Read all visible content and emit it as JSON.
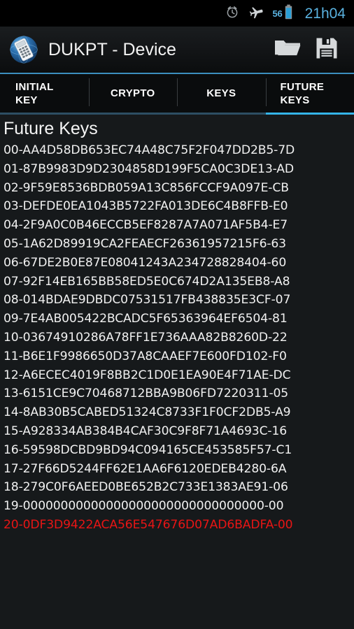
{
  "status_bar": {
    "icons": [
      "alarm-clock-icon",
      "airplane-mode-icon",
      "battery-icon"
    ],
    "battery_percent": "56",
    "time": "21h04",
    "accent_color": "#5ab2e0"
  },
  "action_bar": {
    "app_icon": "dukpt-app-icon",
    "title": "DUKPT - Device",
    "actions": [
      {
        "name": "open-folder-icon",
        "label": "Open"
      },
      {
        "name": "save-disk-icon",
        "label": "Save"
      }
    ],
    "divider_color": "#3c8fbf"
  },
  "tabs": {
    "selected_index": 3,
    "indicator_color": "#34b4e8",
    "items": [
      {
        "label": "INITIAL\nKEY",
        "name": "tab-initial-key"
      },
      {
        "label": "CRYPTO",
        "name": "tab-crypto"
      },
      {
        "label": "KEYS",
        "name": "tab-keys"
      },
      {
        "label": "FUTURE\nKEYS",
        "name": "tab-future-keys"
      }
    ]
  },
  "main": {
    "section_title": "Future Keys",
    "highlight_color": "#e81515",
    "text_color": "#f0f0f0",
    "keys": [
      {
        "text": "00-AA4D58DB653EC74A48C75F2F047DD2B5-7D",
        "highlighted": false
      },
      {
        "text": "01-87B9983D9D2304858D199F5CA0C3DE13-AD",
        "highlighted": false
      },
      {
        "text": "02-9F59E8536BDB059A13C856FCCF9A097E-CB",
        "highlighted": false
      },
      {
        "text": "03-DEFDE0EA1043B5722FA013DE6C4B8FFB-E0",
        "highlighted": false
      },
      {
        "text": "04-2F9A0C0B46ECCB5EF8287A7A071AF5B4-E7",
        "highlighted": false
      },
      {
        "text": "05-1A62D89919CA2FEAECF26361957215F6-63",
        "highlighted": false
      },
      {
        "text": "06-67DE2B0E87E08041243A234728828404-60",
        "highlighted": false
      },
      {
        "text": "07-92F14EB165BB58ED5E0C674D2A135EB8-A8",
        "highlighted": false
      },
      {
        "text": "08-014BDAE9DBDC07531517FB438835E3CF-07",
        "highlighted": false
      },
      {
        "text": "09-7E4AB005422BCADC5F65363964EF6504-81",
        "highlighted": false
      },
      {
        "text": "10-03674910286A78FF1E736AAA82B8260D-22",
        "highlighted": false
      },
      {
        "text": "11-B6E1F9986650D37A8CAAEF7E600FD102-F0",
        "highlighted": false
      },
      {
        "text": "12-A6ECEC4019F8BB2C1D0E1EA90E4F71AE-DC",
        "highlighted": false
      },
      {
        "text": "13-6151CE9C70468712BBA9B06FD7220311-05",
        "highlighted": false
      },
      {
        "text": "14-8AB30B5CABED51324C8733F1F0CF2DB5-A9",
        "highlighted": false
      },
      {
        "text": "15-A928334AB384B4CAF30C9F8F71A4693C-16",
        "highlighted": false
      },
      {
        "text": "16-59598DCBD9BD94C094165CE453585F57-C1",
        "highlighted": false
      },
      {
        "text": "17-27F66D5244FF62E1AA6F6120EDEB4280-6A",
        "highlighted": false
      },
      {
        "text": "18-279C0F6AEED0BE652B2C733E1383AE91-06",
        "highlighted": false
      },
      {
        "text": "19-00000000000000000000000000000000-00",
        "highlighted": false
      },
      {
        "text": "20-0DF3D9422ACA56E547676D07AD6BADFA-00",
        "highlighted": true
      }
    ]
  }
}
